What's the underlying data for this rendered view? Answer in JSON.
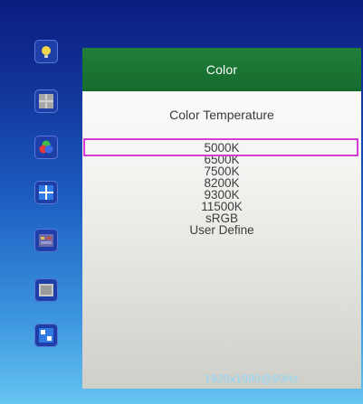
{
  "menu": {
    "title": "Color",
    "section_title": "Color Temperature",
    "options": [
      "5000K",
      "6500K",
      "7500K",
      "8200K",
      "9300K",
      "11500K",
      "sRGB",
      "User Define"
    ],
    "selected_index": 0
  },
  "sidebar": {
    "icons": [
      {
        "name": "brightness-icon"
      },
      {
        "name": "position-icon"
      },
      {
        "name": "color-icon"
      },
      {
        "name": "image-icon"
      },
      {
        "name": "osd-setup-icon"
      },
      {
        "name": "information-icon"
      },
      {
        "name": "misc-icon"
      }
    ]
  },
  "status": {
    "resolution": "1920x1080@60Hz"
  },
  "colors": {
    "header_green": "#1a7531",
    "selection_magenta": "#d83ad8",
    "background_top": "#0b1c7f",
    "background_bottom": "#66c4f0"
  }
}
